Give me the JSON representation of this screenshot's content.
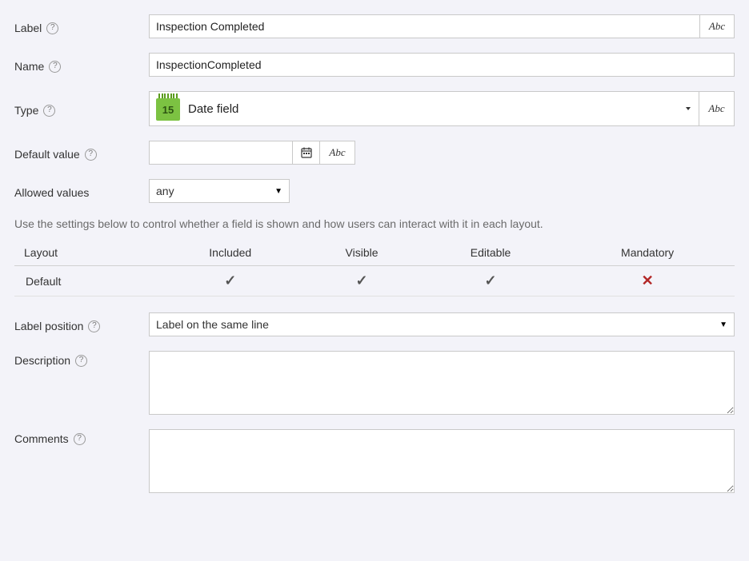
{
  "labels": {
    "label": "Label",
    "name": "Name",
    "type": "Type",
    "default_value": "Default value",
    "allowed_values": "Allowed values",
    "label_position": "Label position",
    "description": "Description",
    "comments": "Comments"
  },
  "values": {
    "label": "Inspection Completed",
    "name": "InspectionCompleted",
    "type_text": "Date field",
    "type_icon_num": "15",
    "default_value": "",
    "allowed_values": "any",
    "label_position": "Label on the same line",
    "description": "",
    "comments": ""
  },
  "abc_label": "Abc",
  "hint": "Use the settings below to control whether a field is shown and how users can interact with it in each layout.",
  "layout_table": {
    "headers": [
      "Layout",
      "Included",
      "Visible",
      "Editable",
      "Mandatory"
    ],
    "rows": [
      {
        "layout": "Default",
        "included": true,
        "visible": true,
        "editable": true,
        "mandatory": false
      }
    ]
  }
}
